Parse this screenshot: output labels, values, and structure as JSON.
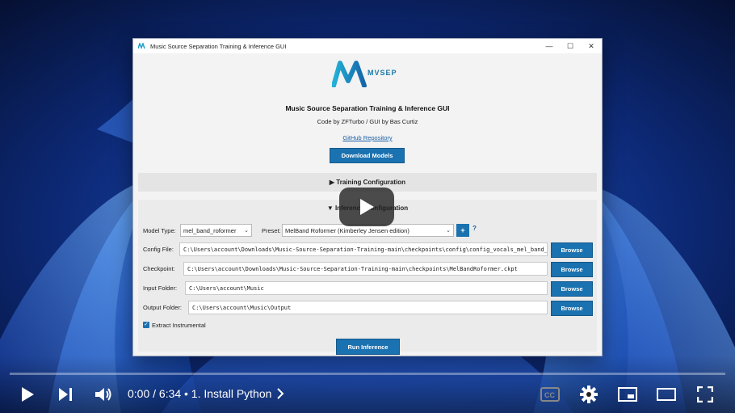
{
  "window": {
    "title": "Music Source Separation Training & Inference GUI",
    "controls": {
      "minimize": "—",
      "maximize": "☐",
      "close": "✕"
    }
  },
  "header": {
    "logo_text": "MVSEP",
    "heading": "Music Source Separation Training & Inference GUI",
    "credits": "Code by ZFTurbo / GUI by Bas Curtiz",
    "repo_link": "GitHub Repository",
    "download_button": "Download Models"
  },
  "sections": {
    "training": "▶ Training Configuration",
    "inference": "▼ Inference Configuration"
  },
  "form": {
    "model_type_label": "Model Type:",
    "model_type_value": "mel_band_roformer",
    "preset_label": "Preset:",
    "preset_value": "MelBand Roformer (Kimberley Jensen edition)",
    "plus": "+",
    "help": "?",
    "config_label": "Config File:",
    "config_value": "C:\\Users\\account\\Downloads\\Music-Source-Separation-Training-main\\checkpoints\\config\\config_vocals_mel_band_roformer.yaml",
    "checkpoint_label": "Checkpoint:",
    "checkpoint_value": "C:\\Users\\account\\Downloads\\Music-Source-Separation-Training-main\\checkpoints\\MelBandRoformer.ckpt",
    "input_label": "Input Folder:",
    "input_value": "C:\\Users\\account\\Music",
    "output_label": "Output Folder:",
    "output_value": "C:\\Users\\account\\Music\\Output",
    "browse_label": "Browse",
    "extract_label": "Extract Instrumental",
    "extract_checked": true,
    "run_button": "Run Inference"
  },
  "player": {
    "time": "0:00 / 6:34",
    "chapter": "• 1. Install Python",
    "progress": 0,
    "icons": [
      "play-icon",
      "next-icon",
      "volume-icon",
      "captions-icon",
      "settings-icon",
      "miniplayer-icon",
      "theater-icon",
      "fullscreen-icon"
    ]
  },
  "colors": {
    "accent": "#1b72b0",
    "link": "#1a5fa8",
    "wallpaper": "#0a1a4a"
  }
}
